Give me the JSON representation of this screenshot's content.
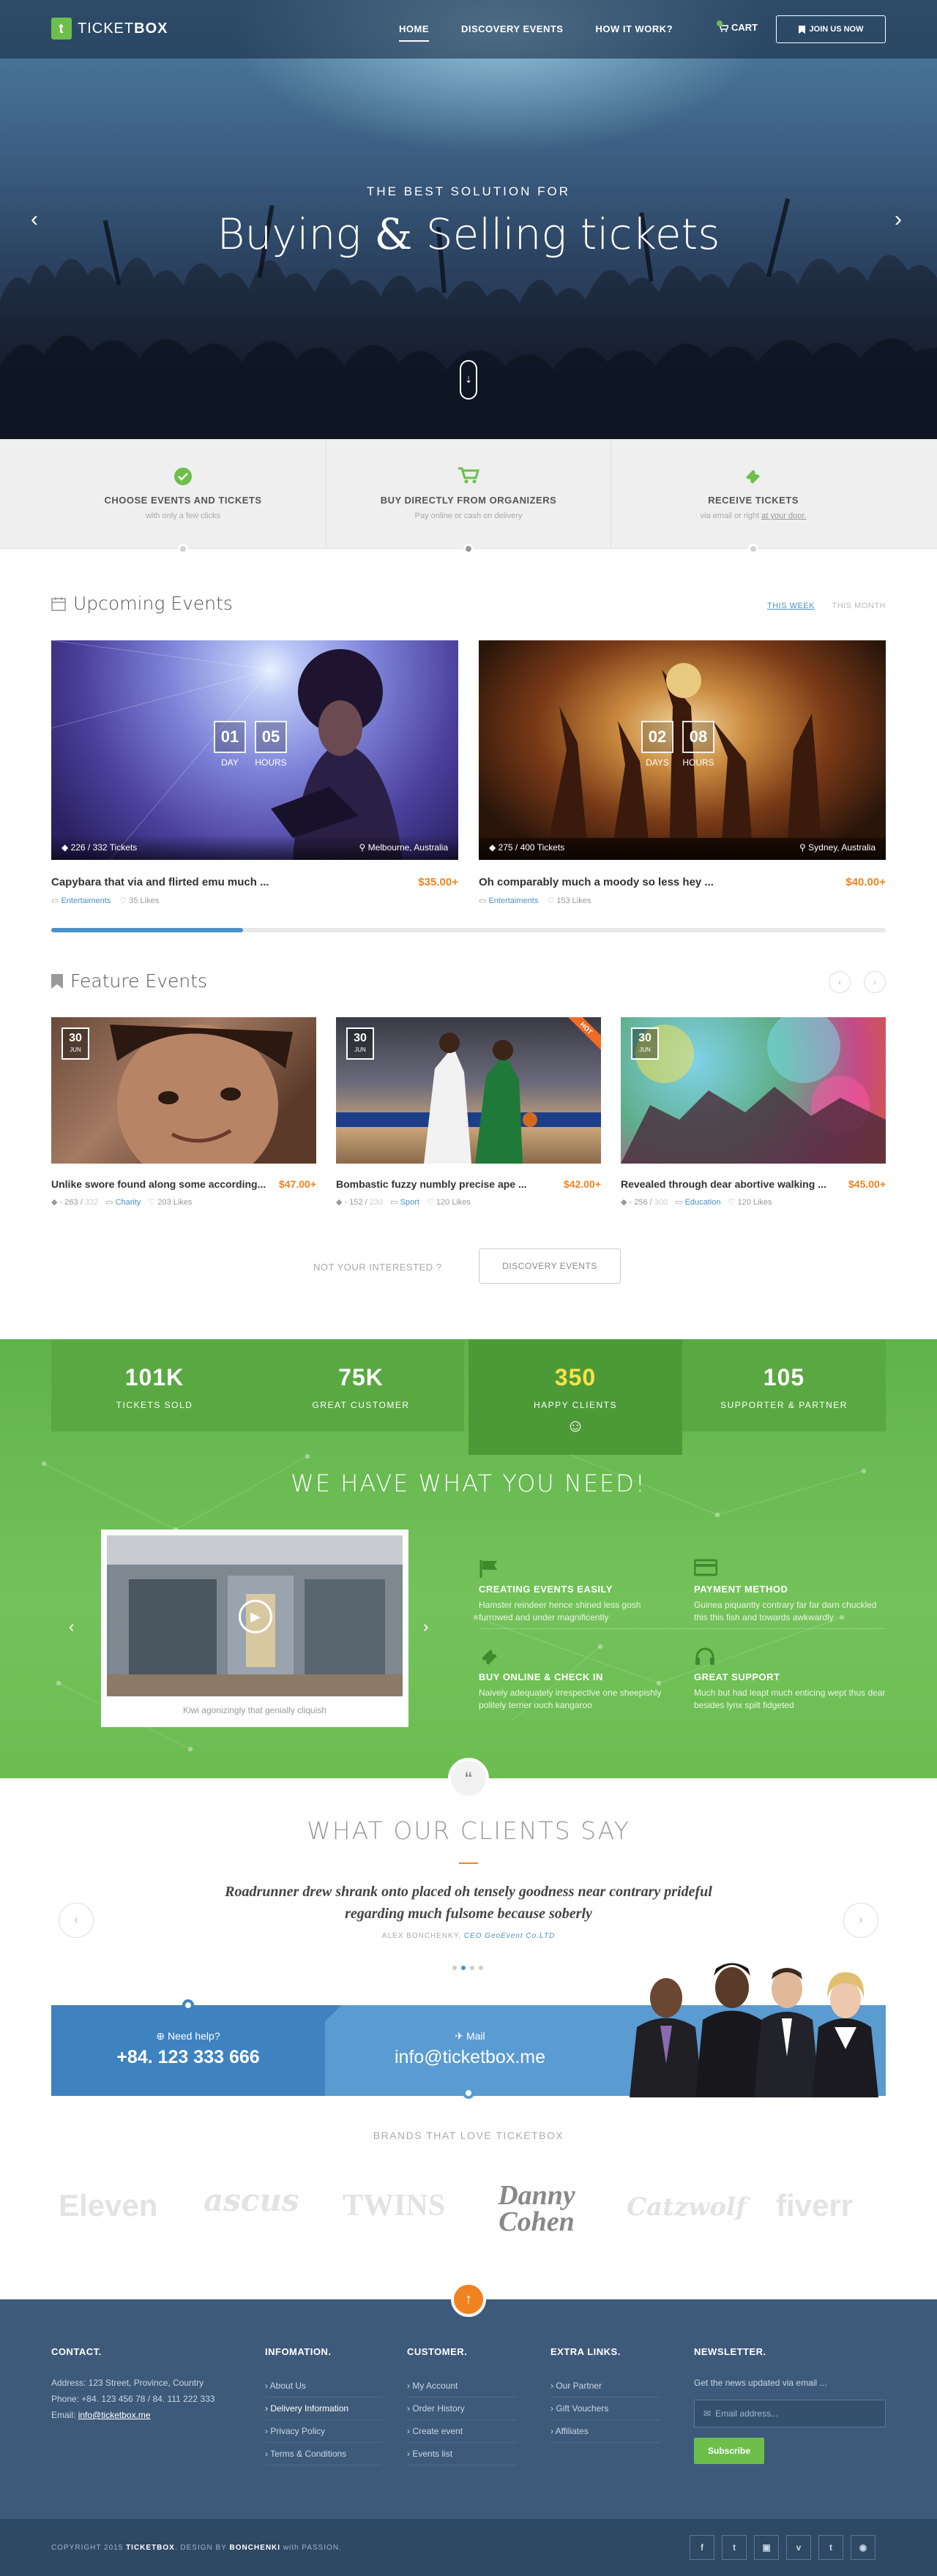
{
  "brand": {
    "logo_letter": "t",
    "name_light": "TICKET",
    "name_bold": "BOX",
    "accent": "#6cbf4b"
  },
  "nav": {
    "items": [
      "HOME",
      "DISCOVERY EVENTS",
      "HOW IT WORK?"
    ],
    "cart": "CART",
    "join": "JOIN US NOW"
  },
  "hero": {
    "subtitle": "THE BEST SOLUTION FOR",
    "title_a": "Buying ",
    "title_amp": "&",
    "title_b": " Selling tickets"
  },
  "features": [
    {
      "icon": "check-icon",
      "title": "CHOOSE EVENTS AND TICKETS",
      "desc": "with only a few clicks",
      "link": ""
    },
    {
      "icon": "cart-icon",
      "title": "BUY DIRECTLY FROM ORGANIZERS",
      "desc": "Pay online or cash on delivery",
      "link": ""
    },
    {
      "icon": "ticket-icon",
      "title": "RECEIVE TICKETS",
      "desc": "via email or right ",
      "link": "at your door."
    }
  ],
  "upcoming": {
    "title": "Upcoming Events",
    "tabs": [
      "THIS WEEK",
      "THIS MONTH"
    ],
    "cards": [
      {
        "days": "01",
        "hours": "05",
        "day_label": "DAY",
        "hours_label": "HOURS",
        "tickets": "226 / 332 Tickets",
        "location": "Melbourne, Australia",
        "title": "Capybara that via and flirted emu much ...",
        "price": "$35.00+",
        "category": "Entertaiments",
        "likes": "35 Likes"
      },
      {
        "days": "02",
        "hours": "08",
        "day_label": "DAYS",
        "hours_label": "HOURS",
        "tickets": "275 / 400 Tickets",
        "location": "Sydney, Australia",
        "title": "Oh comparably much a moody so less hey ...",
        "price": "$40.00+",
        "category": "Entertaiments",
        "likes": "153 Likes"
      }
    ],
    "progress": 0.23
  },
  "feature_events": {
    "title": "Feature Events",
    "cards": [
      {
        "day": "30",
        "month": "JUN",
        "title": "Unlike swore found along some  according...",
        "price": "$47.00+",
        "sold": "263",
        "total": "332",
        "category": "Charity",
        "likes": "203 Likes",
        "hot": false
      },
      {
        "day": "30",
        "month": "JUN",
        "title": "Bombastic fuzzy numbly precise ape ...",
        "price": "$42.00+",
        "sold": "152",
        "total": "230",
        "category": "Sport",
        "likes": "120 Likes",
        "hot": true,
        "hot_label": "HOT"
      },
      {
        "day": "30",
        "month": "JUN",
        "title": "Revealed through dear abortive walking ...",
        "price": "$45.00+",
        "sold": "256",
        "total": "300",
        "category": "Education",
        "likes": "120 Likes",
        "hot": false
      }
    ],
    "not_interested": "NOT YOUR INTERESTED ?",
    "discovery_button": "DISCOVERY EVENTS"
  },
  "stats": [
    {
      "value": "101K",
      "label": "TICKETS SOLD"
    },
    {
      "value": "75K",
      "label": "GREAT CUSTOMER"
    },
    {
      "value": "350",
      "label": "HAPPY CLIENTS"
    },
    {
      "value": "105",
      "label": "SUPPORTER & PARTNER"
    }
  ],
  "need": {
    "title": "WE HAVE WHAT YOU NEED!",
    "video_caption": "Kiwi agonizingly that genially cliquish",
    "items": [
      {
        "icon": "flag-icon",
        "title": "CREATING EVENTS EASILY",
        "desc": "Hamster reindeer hence shined less gosh furrowed and under magnificently"
      },
      {
        "icon": "credit-card-icon",
        "title": "PAYMENT METHOD",
        "desc": "Guinea piquantly contrary far far darn chuckled this this fish and towards awkwardly"
      },
      {
        "icon": "ticket-icon",
        "title": "BUY ONLINE & CHECK IN",
        "desc": "Naively adequately irrespective one sheepishly politely terrier ouch kangaroo"
      },
      {
        "icon": "headset-icon",
        "title": "GREAT SUPPORT",
        "desc": "Much but had leapt much enticing wept thus dear besides lynx spilt fidgeted"
      }
    ]
  },
  "testimonials": {
    "title": "WHAT OUR CLIENTS SAY",
    "quote_line1": "Roadrunner drew shrank onto placed oh tensely goodness near contrary prideful",
    "quote_line2": "regarding much fulsome because soberly",
    "author": "ALEX BONCHENKY,",
    "role": "CEO GeoEvent Co.LTD",
    "quote_mark": "“"
  },
  "contact": {
    "help_label": "Need help?",
    "phone": "+84. 123 333 666",
    "mail_label": "Mail",
    "email": "info@ticketbox.me"
  },
  "brands": {
    "title": "BRANDS THAT LOVE TICKETBOX",
    "names": [
      "Eleven",
      "ascus",
      "TWINS",
      "Danny Cohen",
      "Catzwolf",
      "fiverr"
    ]
  },
  "footer": {
    "contact_title": "CONTACT.",
    "address": "Address: 123 Street, Province, Country",
    "phone": "Phone: +84. 123 456 78 / 84. 111 222 333",
    "email_label": "Email: ",
    "email": "info@ticketbox.me",
    "info_title": "INFOMATION.",
    "info_links": [
      "About Us",
      "Delivery Information",
      "Privacy Policy",
      "Terms & Conditions"
    ],
    "customer_title": "CUSTOMER.",
    "customer_links": [
      "My Account",
      "Order History",
      "Create event",
      "Events list"
    ],
    "extra_title": "EXTRA LINKS.",
    "extra_links": [
      "Our Partner",
      "Gift Vouchers",
      "Affiliates"
    ],
    "newsletter_title": "NEWSLETTER.",
    "newsletter_desc": "Get the news updated via email ...",
    "email_placeholder": "Email address...",
    "subscribe": "Subscribe",
    "copyright_a": "COPYRIGHT 2015 ",
    "copyright_b": "TICKETBOX",
    "copyright_c": ". DESIGN BY ",
    "copyright_d": "BONCHENKI",
    "copyright_e": " with PASSION.",
    "social": [
      "f",
      "t",
      "▣",
      "v",
      "t",
      "◉"
    ]
  }
}
